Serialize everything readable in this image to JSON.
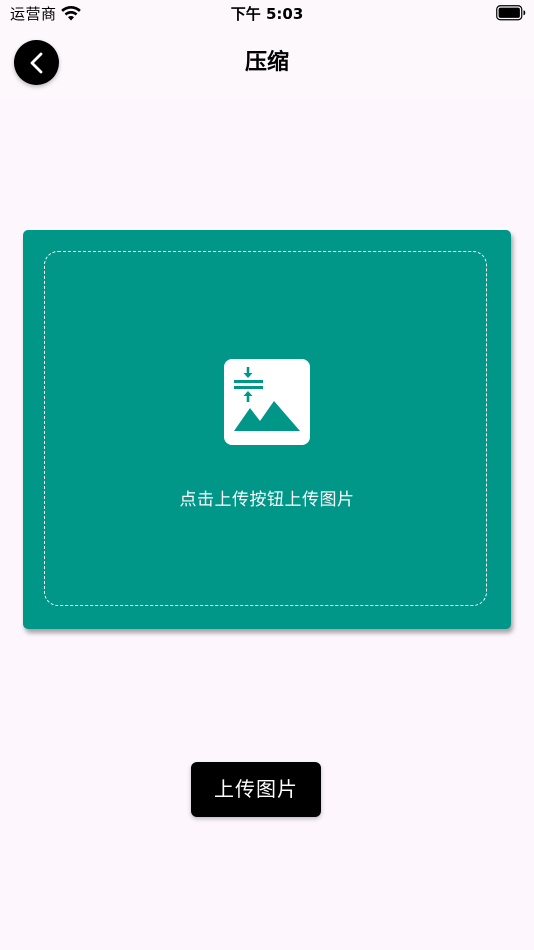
{
  "status_bar": {
    "carrier": "运营商",
    "time": "下午 5:03"
  },
  "nav": {
    "title": "压缩",
    "back_icon": "chevron-left-icon"
  },
  "upload_area": {
    "hint": "点击上传按钮上传图片",
    "icon": "image-compress-icon"
  },
  "upload_button": {
    "label": "上传图片"
  },
  "colors": {
    "accent": "#009688",
    "button": "#000000",
    "background": "#fdf7fd"
  }
}
